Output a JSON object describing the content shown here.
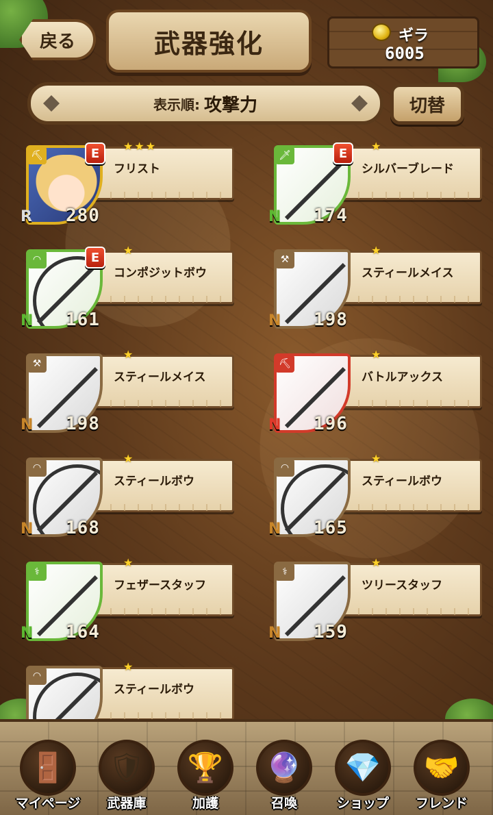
{
  "header": {
    "back_label": "戻る",
    "title": "武器強化",
    "currency_label": "ギラ",
    "currency_value": "6005"
  },
  "sort": {
    "label": "表示順:",
    "value": "攻撃力",
    "switch_label": "切替"
  },
  "weapons": [
    {
      "name": "フリスト",
      "rarity": "R",
      "power": "280",
      "stars": 3,
      "equipped": "E",
      "frame": "gold",
      "type": "axe",
      "is_character": true
    },
    {
      "name": "シルバーブレード",
      "rarity": "N",
      "power": "174",
      "stars": 1,
      "equipped": "E",
      "frame": "green",
      "type": "sword"
    },
    {
      "name": "コンポジットボウ",
      "rarity": "N",
      "power": "161",
      "stars": 1,
      "equipped": "E",
      "frame": "green",
      "type": "bow"
    },
    {
      "name": "スティールメイス",
      "rarity": "N",
      "power": "198",
      "stars": 1,
      "equipped": "",
      "frame": "brown",
      "type": "mace"
    },
    {
      "name": "スティールメイス",
      "rarity": "N",
      "power": "198",
      "stars": 1,
      "equipped": "",
      "frame": "brown",
      "type": "mace"
    },
    {
      "name": "バトルアックス",
      "rarity": "N",
      "power": "196",
      "stars": 1,
      "equipped": "",
      "frame": "red",
      "type": "axe"
    },
    {
      "name": "スティールボウ",
      "rarity": "N",
      "power": "168",
      "stars": 1,
      "equipped": "",
      "frame": "brown",
      "type": "bow"
    },
    {
      "name": "スティールボウ",
      "rarity": "N",
      "power": "165",
      "stars": 1,
      "equipped": "",
      "frame": "brown",
      "type": "bow"
    },
    {
      "name": "フェザースタッフ",
      "rarity": "N",
      "power": "164",
      "stars": 1,
      "equipped": "",
      "frame": "green",
      "type": "staff"
    },
    {
      "name": "ツリースタッフ",
      "rarity": "N",
      "power": "159",
      "stars": 1,
      "equipped": "",
      "frame": "brown",
      "type": "staff"
    },
    {
      "name": "スティールボウ",
      "rarity": "N",
      "power": "",
      "stars": 1,
      "equipped": "",
      "frame": "brown",
      "type": "bow"
    }
  ],
  "nav": [
    {
      "label": "マイページ",
      "icon": "door-icon",
      "glyph": "🚪"
    },
    {
      "label": "武器庫",
      "icon": "shield-sword-icon",
      "glyph": "🛡"
    },
    {
      "label": "加護",
      "icon": "chalice-icon",
      "glyph": "🏆"
    },
    {
      "label": "召喚",
      "icon": "crystal-ball-icon",
      "glyph": "🔮"
    },
    {
      "label": "ショップ",
      "icon": "crystal-icon",
      "glyph": "💎"
    },
    {
      "label": "フレンド",
      "icon": "handshake-icon",
      "glyph": "🤝"
    }
  ],
  "colors": {
    "rarity_N": "#5db832",
    "equip_badge": "#e0401e",
    "star": "#ffd22a"
  }
}
